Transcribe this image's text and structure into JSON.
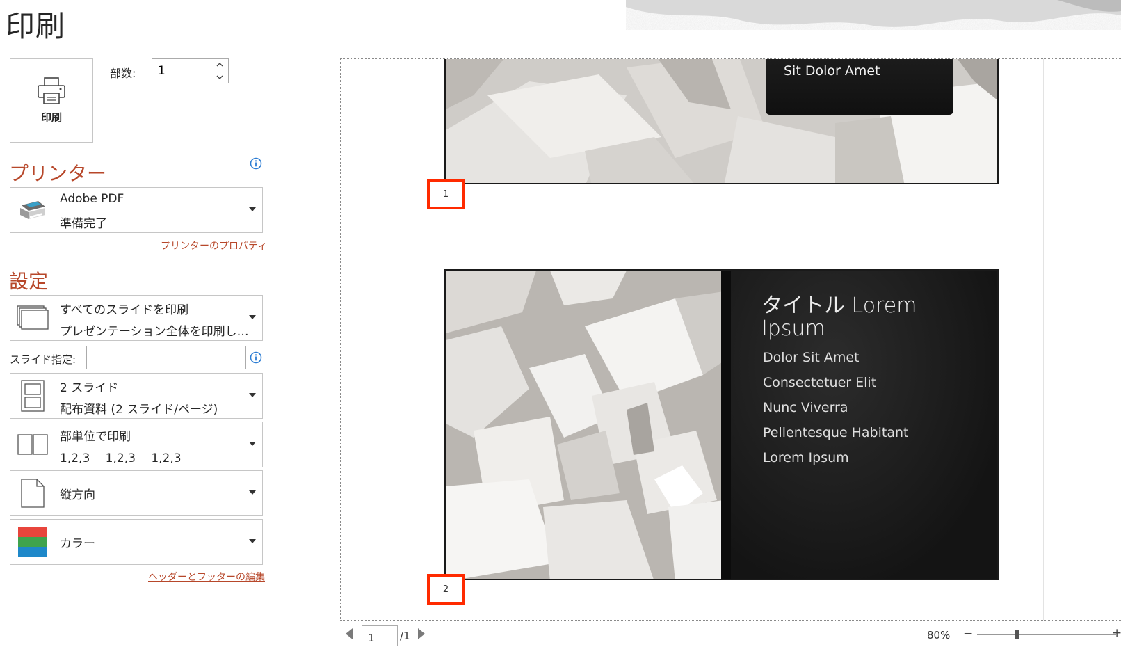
{
  "page_title": "印刷",
  "print_button": {
    "label": "印刷"
  },
  "copies": {
    "label": "部数:",
    "value": "1"
  },
  "printer": {
    "section_title": "プリンター",
    "name": "Adobe PDF",
    "status": "準備完了",
    "properties_link": "プリンターのプロパティ"
  },
  "settings": {
    "section_title": "設定",
    "print_range": {
      "line1": "すべてのスライドを印刷",
      "line2": "プレゼンテーション全体を印刷し…"
    },
    "slides_label": "スライド指定:",
    "slides_value": "",
    "layout": {
      "line1": "2 スライド",
      "line2": "配布資料 (2 スライド/ページ)"
    },
    "collate": {
      "line1": "部単位で印刷",
      "line2": "1,2,3　 1,2,3　 1,2,3"
    },
    "orientation": {
      "label": "縦方向"
    },
    "color": {
      "label": "カラー"
    },
    "header_footer_link": "ヘッダーとフッターの編集"
  },
  "preview": {
    "slide1": {
      "box_text": "Sit Dolor Amet",
      "number": "1"
    },
    "slide2": {
      "title": "タイトル Lorem Ipsum",
      "bullets": [
        "Dolor Sit Amet",
        "Consectetuer Elit",
        "Nunc Viverra",
        "Pellentesque Habitant",
        "Lorem Ipsum"
      ],
      "number": "2"
    }
  },
  "navigation": {
    "current_page": "1",
    "total": "/1"
  },
  "zoom": {
    "label": "80%",
    "minus": "−",
    "plus": "+",
    "level_percent": 80
  },
  "colors": {
    "accent": "#b7472a",
    "highlight_box": "#ff2a00",
    "info_blue": "#2b7cd3"
  }
}
